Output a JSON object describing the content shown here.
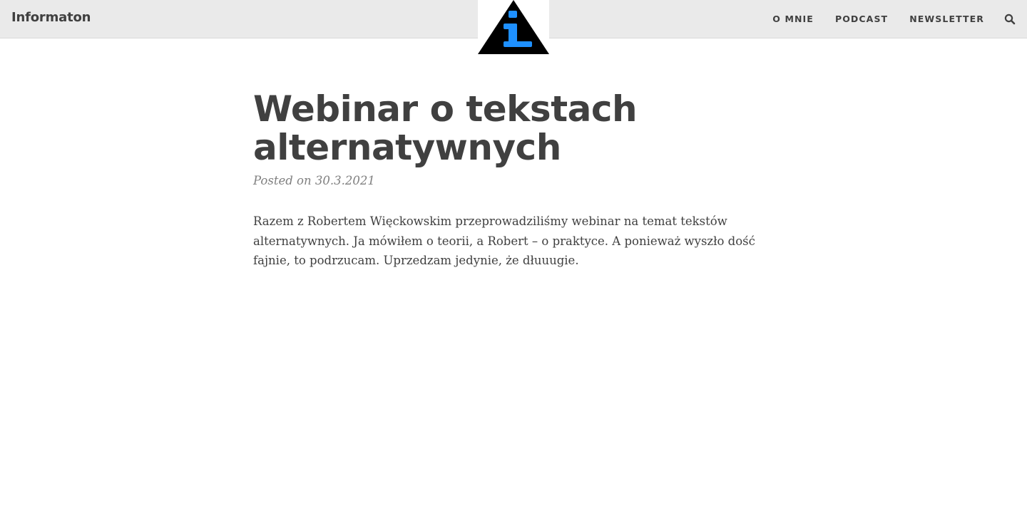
{
  "site": {
    "brand": "Informaton",
    "logo_icon": "info-triangle-icon",
    "logo_colors": {
      "triangle": "#000000",
      "letter": "#1e90ff"
    }
  },
  "nav": {
    "items": [
      {
        "label": "O MNIE"
      },
      {
        "label": "PODCAST"
      },
      {
        "label": "NEWSLETTER"
      }
    ],
    "search_icon": "search-icon"
  },
  "post": {
    "title": "Webinar o tekstach alternatywnych",
    "meta": "Posted on 30.3.2021",
    "body": "Razem z Robertem Więckowskim przeprowadziliśmy webinar na temat tekstów alternatywnych. Ja mówiłem o teorii, a Robert – o praktyce. A ponieważ wyszło dość fajnie, to podrzucam. Uprzedzam jedynie, że dłuuugie."
  },
  "colors": {
    "navbar_bg": "#eaeaea",
    "text": "#404040",
    "meta_text": "#808080"
  }
}
